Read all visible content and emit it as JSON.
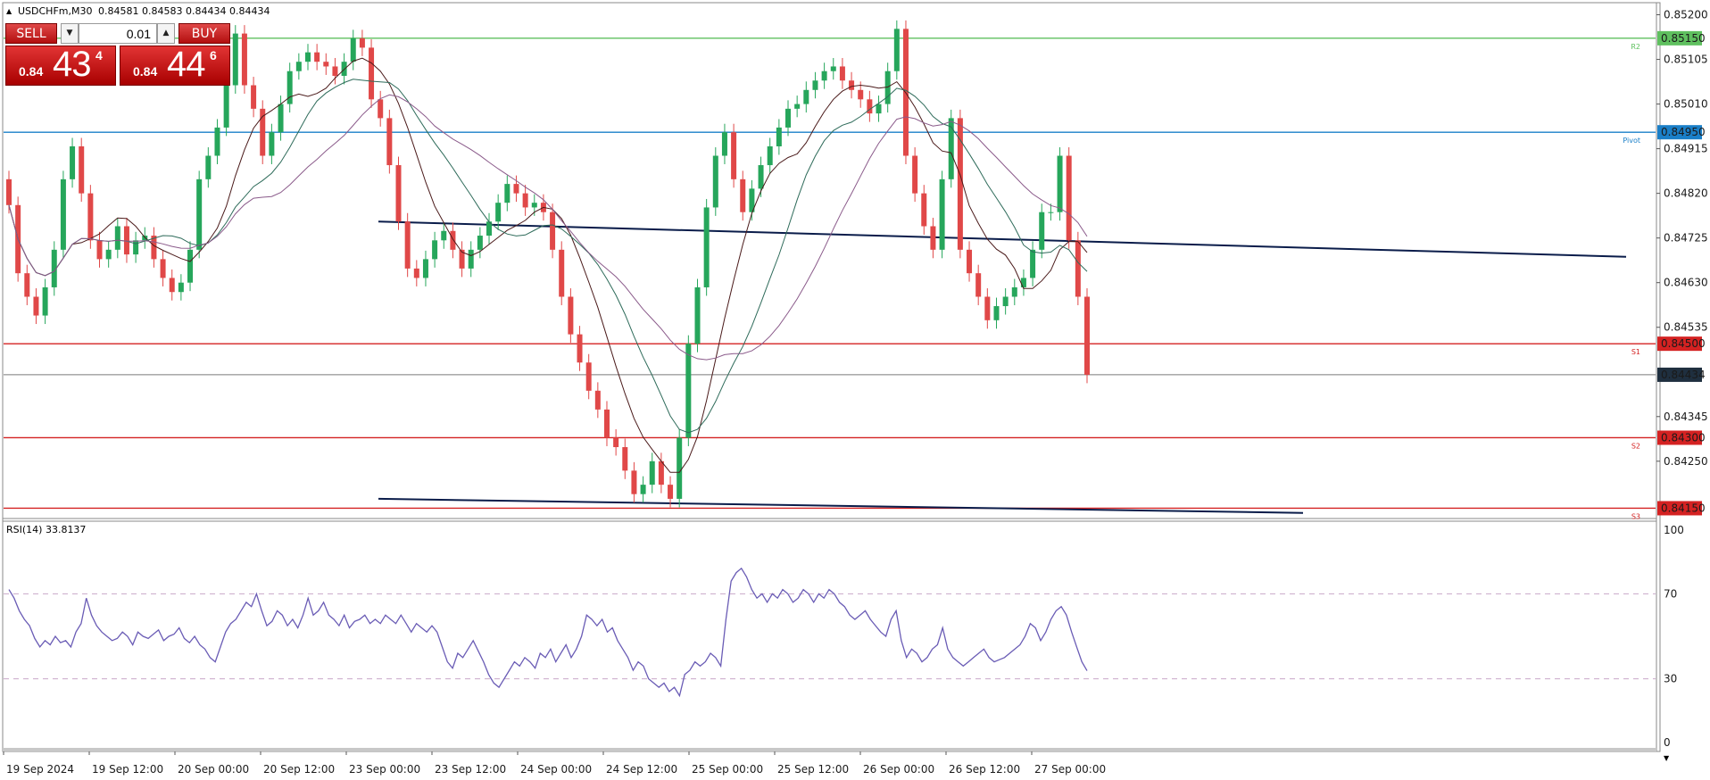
{
  "header": {
    "symbol_caption": "USDCHFm,M30",
    "ohlc": "0.84581 0.84583 0.84434 0.84434"
  },
  "trade_panel": {
    "sell_label": "SELL",
    "buy_label": "BUY",
    "volume_value": "0.01",
    "sell_price": {
      "small": "0.84",
      "big": "43",
      "sup": "4"
    },
    "buy_price": {
      "small": "0.84",
      "big": "44",
      "sup": "6"
    }
  },
  "price_axis": {
    "ticks": [
      "0.85200",
      "0.85105",
      "0.85010",
      "0.84915",
      "0.84820",
      "0.84725",
      "0.84630",
      "0.84535",
      "0.84345",
      "0.84250"
    ],
    "range": [
      0.8413,
      0.8522
    ],
    "tags": [
      {
        "label": "0.85150",
        "value": 0.8515,
        "color": "#5fc05f"
      },
      {
        "label": "0.84950",
        "value": 0.8495,
        "color": "#1a7fc8"
      },
      {
        "label": "0.84500",
        "value": 0.845,
        "color": "#d42222"
      },
      {
        "label": "0.84434",
        "value": 0.84434,
        "color": "#1f2f3f"
      },
      {
        "label": "0.84300",
        "value": 0.843,
        "color": "#d42222"
      },
      {
        "label": "0.84150",
        "value": 0.8415,
        "color": "#d42222"
      }
    ]
  },
  "pivot_levels": [
    {
      "label": "R2",
      "value": 0.8515,
      "color": "#5fc05f"
    },
    {
      "label": "Pivot",
      "value": 0.8495,
      "color": "#1a7fc8"
    },
    {
      "label": "S1",
      "value": 0.845,
      "color": "#d42222"
    },
    {
      "label": "S2",
      "value": 0.843,
      "color": "#d42222"
    },
    {
      "label": "S3",
      "value": 0.8415,
      "color": "#d42222"
    }
  ],
  "bid_line_value": 0.84434,
  "trendlines": [
    {
      "from": 0.8476,
      "to": 0.84685,
      "color": "#0a1c4a"
    },
    {
      "from": 0.8417,
      "to": 0.8414,
      "color": "#0a1c4a"
    }
  ],
  "time_axis": {
    "labels": [
      "19 Sep 2024",
      "19 Sep 12:00",
      "20 Sep 00:00",
      "20 Sep 12:00",
      "23 Sep 00:00",
      "23 Sep 12:00",
      "24 Sep 00:00",
      "24 Sep 12:00",
      "25 Sep 00:00",
      "25 Sep 12:00",
      "26 Sep 00:00",
      "26 Sep 12:00",
      "27 Sep 00:00"
    ]
  },
  "rsi": {
    "caption": "RSI(14) 33.8137",
    "levels": [
      "100",
      "70",
      "30",
      "0"
    ],
    "overbought": 70,
    "oversold": 30,
    "values": [
      72,
      68,
      62,
      58,
      55,
      49,
      45,
      48,
      46,
      50,
      47,
      48,
      45,
      52,
      56,
      68,
      60,
      55,
      52,
      50,
      48,
      49,
      52,
      50,
      46,
      52,
      50,
      49,
      51,
      53,
      48,
      50,
      51,
      54,
      49,
      47,
      50,
      46,
      44,
      40,
      38,
      45,
      52,
      56,
      58,
      62,
      66,
      64,
      70,
      62,
      55,
      57,
      62,
      60,
      55,
      58,
      54,
      60,
      68,
      60,
      62,
      66,
      60,
      58,
      55,
      60,
      54,
      57,
      58,
      60,
      56,
      58,
      56,
      60,
      58,
      56,
      60,
      56,
      52,
      56,
      54,
      52,
      55,
      52,
      45,
      38,
      35,
      42,
      40,
      44,
      48,
      43,
      38,
      32,
      28,
      26,
      30,
      34,
      38,
      36,
      40,
      38,
      35,
      42,
      40,
      44,
      38,
      42,
      46,
      40,
      44,
      50,
      60,
      58,
      55,
      58,
      52,
      54,
      48,
      44,
      40,
      34,
      38,
      36,
      30,
      28,
      26,
      28,
      24,
      26,
      22,
      32,
      34,
      38,
      36,
      38,
      42,
      40,
      36,
      58,
      76,
      80,
      82,
      78,
      72,
      68,
      70,
      66,
      70,
      68,
      72,
      70,
      66,
      68,
      72,
      70,
      66,
      70,
      68,
      72,
      70,
      66,
      64,
      60,
      58,
      60,
      62,
      58,
      55,
      52,
      50,
      58,
      62,
      48,
      40,
      44,
      42,
      38,
      40,
      44,
      46,
      54,
      44,
      40,
      38,
      36,
      38,
      40,
      42,
      44,
      40,
      38,
      39,
      40,
      42,
      44,
      46,
      50,
      56,
      54,
      48,
      52,
      58,
      62,
      64,
      60,
      52,
      45,
      38,
      33.8
    ],
    "color": "#6a5cb5"
  },
  "candles": {
    "open": [
      0.8485,
      0.84795,
      0.8465,
      0.846,
      0.8456,
      0.8462,
      0.847,
      0.8485,
      0.8492,
      0.8482,
      0.8472,
      0.8468,
      0.847,
      0.8475,
      0.8469,
      0.8472,
      0.8473,
      0.8468,
      0.8464,
      0.8461,
      0.8463,
      0.847,
      0.8485,
      0.849,
      0.8496,
      0.8505,
      0.8516,
      0.8505,
      0.85,
      0.849,
      0.8495,
      0.8501,
      0.8508,
      0.851,
      0.8512,
      0.851,
      0.8509,
      0.8507,
      0.851,
      0.8515,
      0.8513,
      0.8502,
      0.8498,
      0.8488,
      0.8476,
      0.8466,
      0.8464,
      0.8468,
      0.8472,
      0.8474,
      0.847,
      0.8466,
      0.847,
      0.8473,
      0.8476,
      0.848,
      0.8484,
      0.8482,
      0.8479,
      0.848,
      0.8478,
      0.847,
      0.846,
      0.8452,
      0.8446,
      0.844,
      0.8436,
      0.843,
      0.8428,
      0.8423,
      0.8418,
      0.842,
      0.8425,
      0.842,
      0.8417,
      0.843,
      0.845,
      0.8462,
      0.8479,
      0.849,
      0.8495,
      0.8485,
      0.8478,
      0.8483,
      0.8488,
      0.8492,
      0.8496,
      0.85,
      0.8501,
      0.8504,
      0.8506,
      0.8508,
      0.8509,
      0.8506,
      0.8504,
      0.8502,
      0.8499,
      0.8501,
      0.8508,
      0.8517,
      0.849,
      0.8482,
      0.8475,
      0.847,
      0.8485,
      0.8498,
      0.847,
      0.8465,
      0.846,
      0.8455,
      0.8458,
      0.846,
      0.8462,
      0.8464,
      0.847,
      0.8478,
      0.8478,
      0.849,
      0.8472,
      0.846
    ],
    "close": [
      0.84795,
      0.8465,
      0.846,
      0.8456,
      0.8462,
      0.847,
      0.8485,
      0.8492,
      0.8482,
      0.8472,
      0.8468,
      0.847,
      0.8475,
      0.8469,
      0.8472,
      0.8473,
      0.8468,
      0.8464,
      0.8461,
      0.8463,
      0.847,
      0.8485,
      0.849,
      0.8496,
      0.8505,
      0.8516,
      0.8505,
      0.85,
      0.849,
      0.8495,
      0.8501,
      0.8508,
      0.851,
      0.8512,
      0.851,
      0.8509,
      0.8507,
      0.851,
      0.8515,
      0.8513,
      0.8502,
      0.8498,
      0.8488,
      0.8476,
      0.8466,
      0.8464,
      0.8468,
      0.8472,
      0.8474,
      0.847,
      0.8466,
      0.847,
      0.8473,
      0.8476,
      0.848,
      0.8484,
      0.8482,
      0.8479,
      0.848,
      0.8478,
      0.847,
      0.846,
      0.8452,
      0.8446,
      0.844,
      0.8436,
      0.843,
      0.8428,
      0.8423,
      0.8418,
      0.842,
      0.8425,
      0.842,
      0.8417,
      0.843,
      0.845,
      0.8462,
      0.8479,
      0.849,
      0.8495,
      0.8485,
      0.8478,
      0.8483,
      0.8488,
      0.8492,
      0.8496,
      0.85,
      0.8501,
      0.8504,
      0.8506,
      0.8508,
      0.8509,
      0.8506,
      0.8504,
      0.8502,
      0.8499,
      0.8501,
      0.8508,
      0.8517,
      0.849,
      0.8482,
      0.8475,
      0.847,
      0.8485,
      0.8498,
      0.847,
      0.8465,
      0.846,
      0.8455,
      0.8458,
      0.846,
      0.8462,
      0.8464,
      0.847,
      0.8478,
      0.8478,
      0.849,
      0.8472,
      0.846,
      0.84434
    ]
  }
}
